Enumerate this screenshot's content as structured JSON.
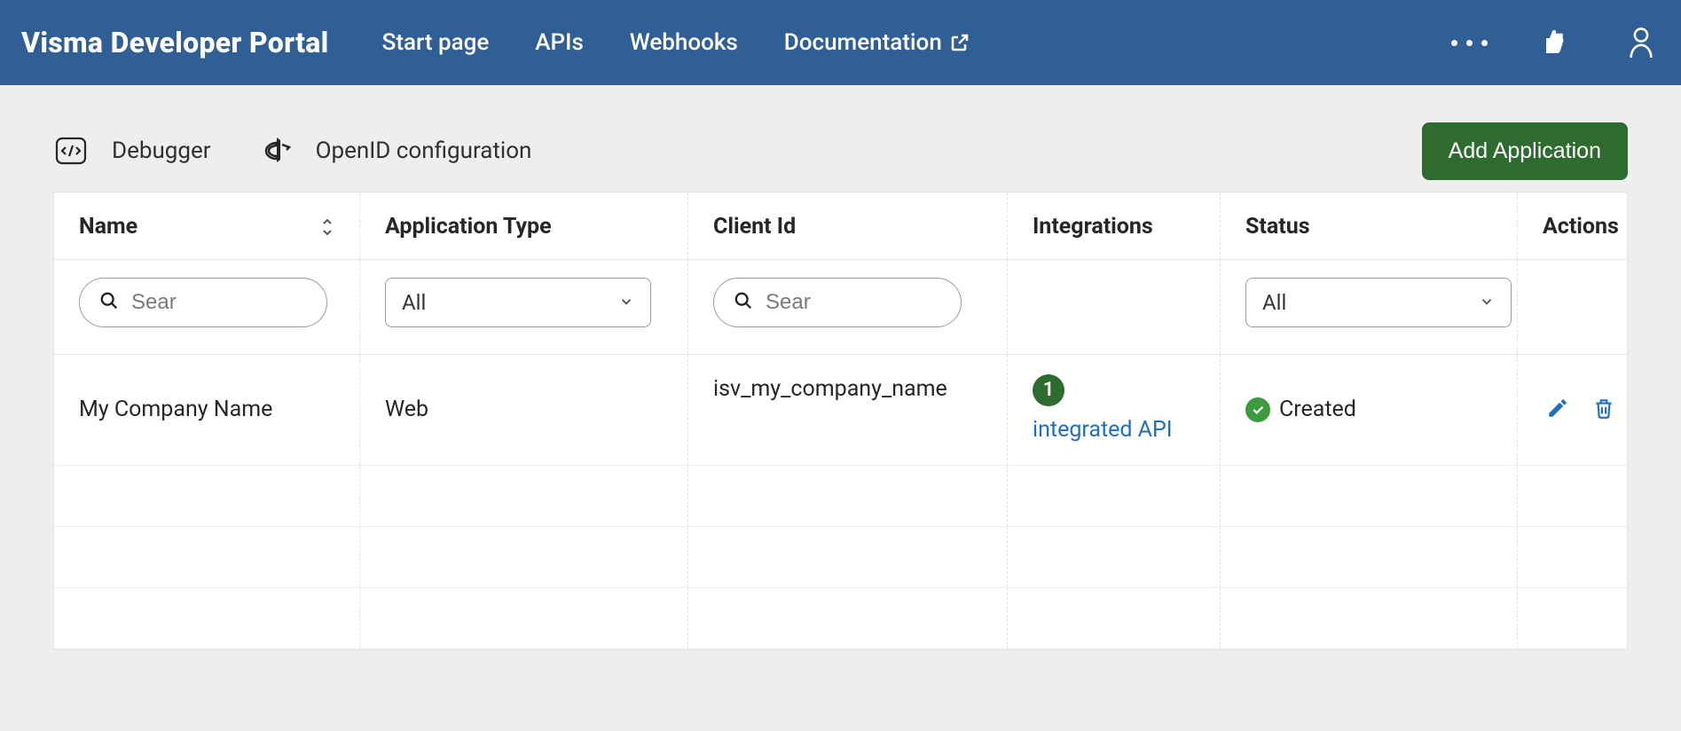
{
  "header": {
    "brand": "Visma Developer Portal",
    "nav": {
      "start": "Start page",
      "apis": "APIs",
      "webhooks": "Webhooks",
      "documentation": "Documentation"
    }
  },
  "toolbar": {
    "debugger": "Debugger",
    "openid": "OpenID configuration",
    "add_app": "Add Application"
  },
  "table": {
    "headers": {
      "name": "Name",
      "app_type": "Application Type",
      "client_id": "Client Id",
      "integrations": "Integrations",
      "status": "Status",
      "actions": "Actions"
    },
    "filters": {
      "name_placeholder": "Sear",
      "type_value": "All",
      "client_placeholder": "Sear",
      "status_value": "All"
    },
    "rows": [
      {
        "name": "My Company Name",
        "type": "Web",
        "client_id": "isv_my_company_name",
        "integration_count": "1",
        "integration_link": "integrated API",
        "status": "Created"
      }
    ]
  }
}
